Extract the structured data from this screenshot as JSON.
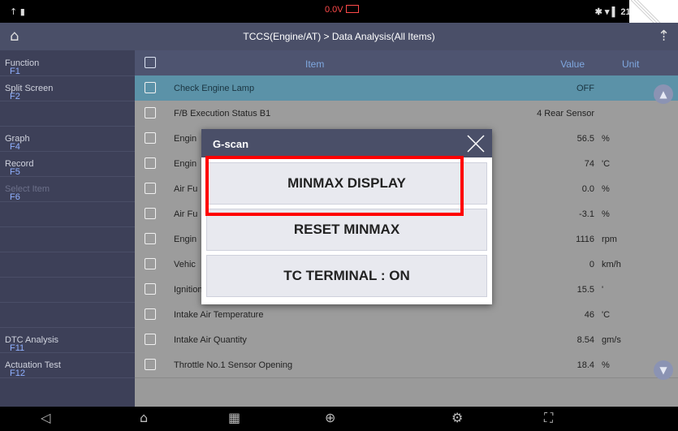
{
  "statusbar": {
    "left": "↑ ▮",
    "center": "0.0V",
    "right": "✱ ▾ ▌ 21% 3:26 PM"
  },
  "titlebar": {
    "title": "TCCS(Engine/AT) > Data Analysis(All Items)"
  },
  "sidebar": {
    "items": [
      {
        "key": "F1",
        "label": "Function"
      },
      {
        "key": "F2",
        "label": "Split Screen"
      },
      {
        "key": "",
        "label": ""
      },
      {
        "key": "F4",
        "label": "Graph"
      },
      {
        "key": "F5",
        "label": "Record"
      },
      {
        "key": "F6",
        "label": "Select Item"
      },
      {
        "key": "",
        "label": ""
      },
      {
        "key": "",
        "label": ""
      },
      {
        "key": "",
        "label": ""
      },
      {
        "key": "",
        "label": ""
      },
      {
        "key": "F11",
        "label": "DTC Analysis"
      },
      {
        "key": "F12",
        "label": "Actuation Test"
      },
      {
        "key": "",
        "label": ""
      },
      {
        "key": "",
        "label": ""
      }
    ]
  },
  "table": {
    "headers": {
      "item": "Item",
      "value": "Value",
      "unit": "Unit"
    },
    "rows": [
      {
        "item": "Check Engine Lamp",
        "value": "OFF",
        "unit": ""
      },
      {
        "item": "F/B Execution Status B1",
        "value": "4 Rear Sensor",
        "unit": ""
      },
      {
        "item": "Engin",
        "value": "56.5",
        "unit": "%"
      },
      {
        "item": "Engin",
        "value": "74",
        "unit": "'C"
      },
      {
        "item": "Air Fu",
        "value": "0.0",
        "unit": "%"
      },
      {
        "item": "Air Fu",
        "value": "-3.1",
        "unit": "%"
      },
      {
        "item": "Engin",
        "value": "1116",
        "unit": "rpm"
      },
      {
        "item": "Vehic",
        "value": "0",
        "unit": "km/h"
      },
      {
        "item": "Ignition Timing (#1)",
        "value": "15.5",
        "unit": "'"
      },
      {
        "item": "Intake Air Temperature",
        "value": "46",
        "unit": "'C"
      },
      {
        "item": "Intake Air Quantity",
        "value": "8.54",
        "unit": "gm/s"
      },
      {
        "item": "Throttle No.1 Sensor Opening",
        "value": "18.4",
        "unit": "%"
      }
    ]
  },
  "dialog": {
    "title": "G-scan",
    "buttons": [
      "MINMAX DISPLAY",
      "RESET MINMAX",
      "TC TERMINAL : ON"
    ]
  },
  "navbar": {
    "icons": [
      "back-icon",
      "home-icon",
      "apps-icon",
      "globe-icon",
      "settings-icon",
      "fullscreen-icon"
    ]
  },
  "colors": {
    "accent": "#4a4f68",
    "selected_row": "#5b92a8",
    "highlight": "#ff0000"
  }
}
